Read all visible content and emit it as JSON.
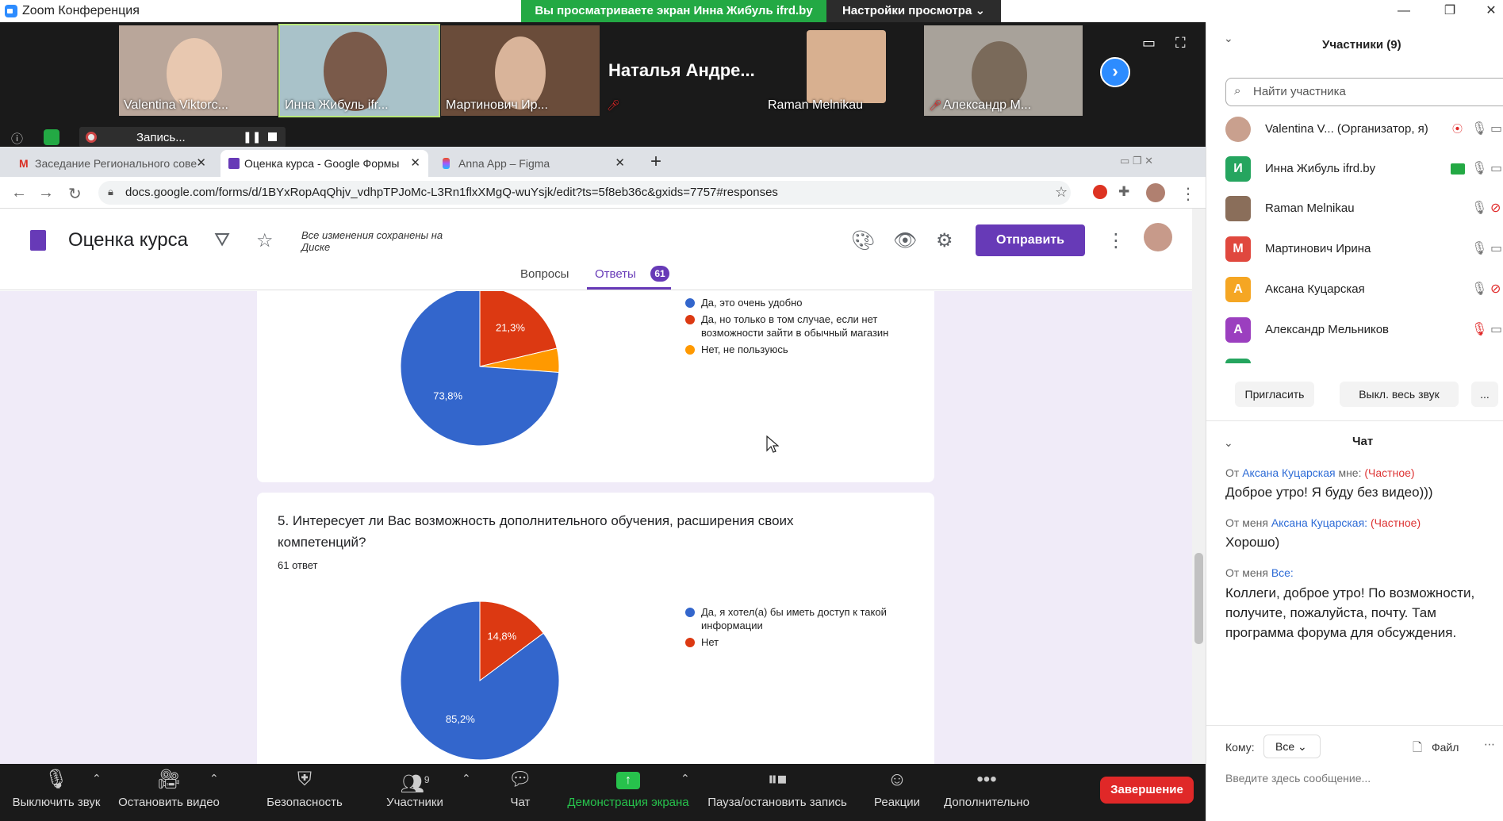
{
  "window": {
    "title": "Zoom Конференция"
  },
  "banner": {
    "viewing": "Вы просматриваете экран Инна Жибуль ifrd.by",
    "view_settings": "Настройки просмотра ⌄"
  },
  "videos": [
    {
      "name": "Valentina Viktorc..."
    },
    {
      "name": "Инна Жибуль ifr..."
    },
    {
      "name": "Мартинович Ир..."
    },
    {
      "name": "Наталья Андре..."
    },
    {
      "name": "Raman Melnikau"
    },
    {
      "name": "Александр М..."
    }
  ],
  "recording": {
    "label": "Запись..."
  },
  "browser": {
    "tabs": [
      {
        "label": "Заседание Регионального сове"
      },
      {
        "label": "Оценка курса - Google Формы"
      },
      {
        "label": "Anna App – Figma"
      }
    ],
    "url": "docs.google.com/forms/d/1BYxRopAqQhjv_vdhpTPJoMc-L3Rn1flxXMgQ-wuYsjk/edit?ts=5f8eb36c&gxids=7757#responses"
  },
  "form": {
    "title": "Оценка курса",
    "saved_note": "Все изменения сохранены на Диске",
    "send_label": "Отправить",
    "tab_questions": "Вопросы",
    "tab_answers": "Ответы",
    "answers_count": "61"
  },
  "questions": {
    "q4": {
      "legend": [
        "Да, это очень удобно",
        "Да, но только в том случае, если нет возможности зайти в обычный магазин",
        "Нет, не пользуюсь"
      ]
    },
    "q5": {
      "title": "5. Интересует ли Вас возможность дополнительного обучения, расширения своих компетенций?",
      "count": "61 ответ",
      "legend": [
        "Да, я хотел(а) бы иметь доступ к такой информации",
        "Нет"
      ]
    }
  },
  "chart_data": [
    {
      "type": "pie",
      "categories": [
        "Да, это очень удобно",
        "Да, но только в том случае, если нет возможности зайти в обычный магазин",
        "Нет, не пользуюсь"
      ],
      "values": [
        73.8,
        21.3,
        4.9
      ],
      "data_labels": [
        "73,8%",
        "21,3%",
        ""
      ],
      "colors": [
        "#3366cc",
        "#dc3912",
        "#ff9900"
      ],
      "legend": "right"
    },
    {
      "type": "pie",
      "title": "5. Интересует ли Вас возможность дополнительного обучения, расширения своих компетенций?",
      "categories": [
        "Да, я хотел(а) бы иметь доступ к такой информации",
        "Нет"
      ],
      "values": [
        85.2,
        14.8
      ],
      "data_labels": [
        "85,2%",
        "14,8%"
      ],
      "colors": [
        "#3366cc",
        "#dc3912"
      ],
      "legend": "right"
    }
  ],
  "toolbar": {
    "mute": "Выключить звук",
    "video": "Остановить видео",
    "security": "Безопасность",
    "participants": "Участники",
    "participants_count": "9",
    "chat": "Чат",
    "share": "Демонстрация экрана",
    "pause_rec": "Пауза/остановить запись",
    "reactions": "Реакции",
    "more": "Дополнительно",
    "end": "Завершение"
  },
  "panel": {
    "participants_title": "Участники (9)",
    "search_placeholder": "Найти участника",
    "participants": [
      {
        "name": "Valentina V...  (Организатор, я)",
        "initial": "",
        "color": "#c9a08e"
      },
      {
        "name": "Инна Жибуль ifrd.by",
        "initial": "И",
        "color": "#25a55f"
      },
      {
        "name": "Raman Melnikau",
        "initial": "",
        "color": "#8a6e5a"
      },
      {
        "name": "Мартинович Ирина",
        "initial": "М",
        "color": "#e0483e"
      },
      {
        "name": "Аксана Куцарская",
        "initial": "А",
        "color": "#f5a623"
      },
      {
        "name": "Александр Мельников",
        "initial": "А",
        "color": "#9b3fbf"
      }
    ],
    "invite": "Пригласить",
    "mute_all": "Выкл. весь звук",
    "more": "...",
    "chat_title": "Чат",
    "messages": [
      {
        "prefix": "От",
        "who": "Аксана Куцарская",
        "mid": "мне:",
        "priv": "(Частное)",
        "text": "Доброе утро! Я буду без видео)))"
      },
      {
        "prefix": "От меня",
        "who": "Аксана Куцарская:",
        "mid": "",
        "priv": "(Частное)",
        "text": "Хорошо)"
      },
      {
        "prefix": "От меня",
        "who": "Все:",
        "mid": "",
        "priv": "",
        "text": "Коллеги, доброе утро! По возможности, получите, пожалуйста, почту. Там программа форума для обсуждения."
      }
    ],
    "to_label": "Кому:",
    "to_value": "Все",
    "file_label": "Файл",
    "composer_placeholder": "Введите здесь сообщение..."
  }
}
